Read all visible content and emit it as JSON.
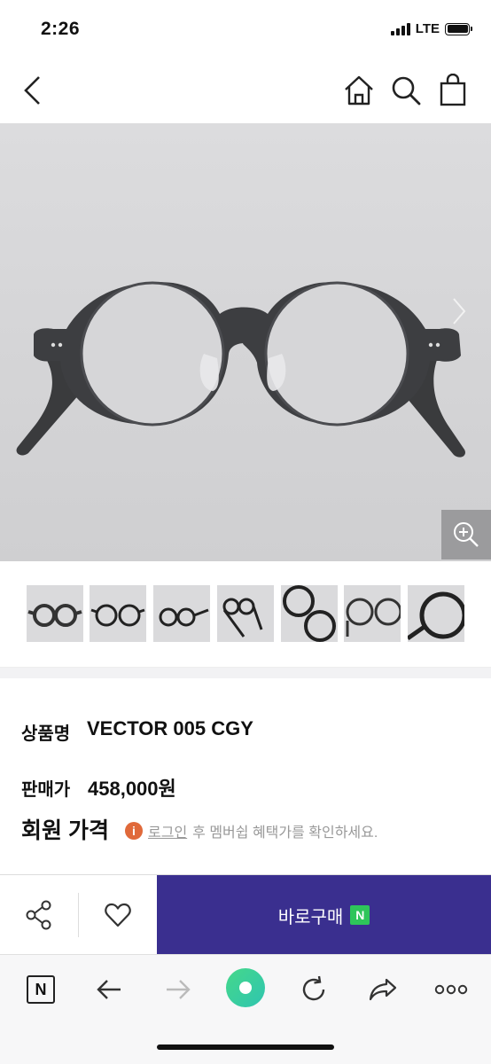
{
  "status_bar": {
    "time": "2:26",
    "network": "LTE"
  },
  "nav": {
    "icons": [
      "back-icon",
      "home-icon",
      "search-icon",
      "bag-icon"
    ]
  },
  "product_image": {
    "icons": [
      "chevron-right-icon",
      "zoom-in-icon"
    ]
  },
  "thumbnails": {
    "count": 7
  },
  "product": {
    "name_label": "상품명",
    "name_value": "VECTOR 005 CGY",
    "price_label": "판매가",
    "price_value": "458,000원",
    "member_price_title": "회원 가격",
    "member_note_link": "로그인",
    "member_note_text": "후 멤버쉽 혜택가를 확인하세요."
  },
  "action_bar": {
    "buy_label": "바로구매",
    "npay_badge": "N"
  },
  "browser_bar": {
    "naver_label": "N",
    "icons": [
      "naver-icon",
      "back-arrow-icon",
      "forward-arrow-icon",
      "green-dot-icon",
      "reload-icon",
      "share-arrow-icon",
      "more-icon"
    ]
  },
  "colors": {
    "buy_button": "#3a2f8f",
    "npay_green": "#2ec55a",
    "info_orange": "#e0693a",
    "green_dot": "#3fd39a"
  }
}
